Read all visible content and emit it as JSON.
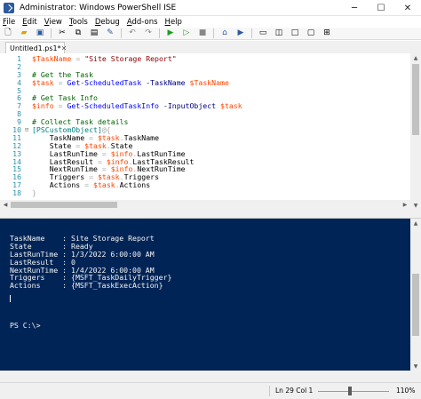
{
  "window": {
    "title": "Administrator: Windows PowerShell ISE",
    "minimize": "─",
    "maximize": "☐",
    "close": "✕"
  },
  "menu": [
    "File",
    "Edit",
    "View",
    "Tools",
    "Debug",
    "Add-ons",
    "Help"
  ],
  "menu_underline": [
    "F",
    "E",
    "V",
    "T",
    "D",
    "A",
    "H"
  ],
  "toolbar_icons": [
    "new-icon",
    "open-icon",
    "save-icon",
    "cut-icon",
    "copy-icon",
    "paste-icon",
    "clear-icon",
    "undo-icon",
    "redo-icon",
    "run-icon",
    "run-selection-icon",
    "stop-icon",
    "remote-icon",
    "powershell-icon",
    "layout-script-top-icon",
    "layout-script-right-icon",
    "layout-maximized-icon",
    "layout-hide-icon",
    "command-pane-icon"
  ],
  "tab": {
    "label": "Untitled1.ps1*",
    "close": "✕"
  },
  "editor_lines": [
    {
      "n": "1",
      "fold": "",
      "text": "$TaskName = \"Site Storage Report\""
    },
    {
      "n": "2",
      "fold": "",
      "text": ""
    },
    {
      "n": "3",
      "fold": "",
      "text": "# Get the Task"
    },
    {
      "n": "4",
      "fold": "",
      "text": "$task = Get-ScheduledTask -TaskName $TaskName"
    },
    {
      "n": "5",
      "fold": "",
      "text": ""
    },
    {
      "n": "6",
      "fold": "",
      "text": "# Get Task Info"
    },
    {
      "n": "7",
      "fold": "",
      "text": "$info = Get-ScheduledTaskInfo -InputObject $task"
    },
    {
      "n": "8",
      "fold": "",
      "text": ""
    },
    {
      "n": "9",
      "fold": "",
      "text": "# Collect Task details"
    },
    {
      "n": "10",
      "fold": "⊟",
      "text": "[PSCustomObject]@{"
    },
    {
      "n": "11",
      "fold": "",
      "text": "    TaskName = $task.TaskName"
    },
    {
      "n": "12",
      "fold": "",
      "text": "    State = $task.State"
    },
    {
      "n": "13",
      "fold": "",
      "text": "    LastRunTime = $info.LastRunTime"
    },
    {
      "n": "14",
      "fold": "",
      "text": "    LastResult = $info.LastTaskResult"
    },
    {
      "n": "15",
      "fold": "",
      "text": "    NextRunTime = $info.NextRunTime"
    },
    {
      "n": "16",
      "fold": "",
      "text": "    Triggers = $task.Triggers"
    },
    {
      "n": "17",
      "fold": "",
      "text": "    Actions = $task.Actions"
    },
    {
      "n": "18",
      "fold": "",
      "text": "}"
    }
  ],
  "console_lines": [
    "TaskName    : Site Storage Report",
    "State       : Ready",
    "LastRunTime : 1/3/2022 6:00:00 AM",
    "LastResult  : 0",
    "NextRunTime : 1/4/2022 6:00:00 AM",
    "Triggers    : {MSFT_TaskDailyTrigger}",
    "Actions     : {MSFT_TaskExecAction}",
    "",
    "",
    "",
    "",
    "PS C:\\>"
  ],
  "status": {
    "position": "Ln 29  Col 1",
    "zoom": "110%",
    "zoom_level": 0.45
  },
  "colors": {
    "console_bg": "#012456",
    "variable": "#ff4500",
    "string": "#8b0000",
    "comment": "#006400",
    "line_number": "#2b91af"
  }
}
